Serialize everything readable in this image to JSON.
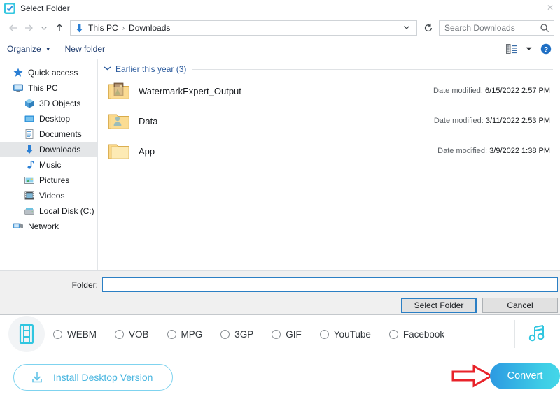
{
  "app": {
    "formats": [
      {
        "label": "WEBM",
        "selected": false
      },
      {
        "label": "VOB",
        "selected": false
      },
      {
        "label": "MPG",
        "selected": false
      },
      {
        "label": "3GP",
        "selected": false
      },
      {
        "label": "GIF",
        "selected": false
      },
      {
        "label": "YouTube",
        "selected": false
      },
      {
        "label": "Facebook",
        "selected": false
      }
    ],
    "film_icon": "film-strip-icon",
    "music_icon": "music-note-icon",
    "install_button": "Install Desktop Version",
    "install_icon": "download-icon",
    "convert_button": "Convert",
    "annotation_icon": "red-arrow-pointer",
    "colors": {
      "convert_gradient_start": "#2c9ae2",
      "convert_gradient_end": "#44d6e8",
      "install_accent": "#49b6e0",
      "annotation_red": "#e8232a"
    }
  },
  "dialog": {
    "title": "Select Folder",
    "title_icon": "checkmark-app-icon",
    "close_label": "✕",
    "nav": {
      "back_icon": "arrow-left-icon",
      "forward_icon": "arrow-right-icon",
      "recent_icon": "chevron-down-icon",
      "up_icon": "arrow-up-icon",
      "breadcrumb_icon": "downloads-arrow-icon",
      "breadcrumbs": [
        "This PC",
        "Downloads"
      ],
      "separator": "›",
      "address_chevron": "⌄",
      "refresh_icon": "refresh-icon",
      "refresh_glyph": "↻"
    },
    "search": {
      "placeholder": "Search Downloads",
      "icon": "search-icon"
    },
    "commands": {
      "organize": "Organize",
      "organize_caret": "▼",
      "new_folder": "New folder",
      "view_icon": "view-mode-icon",
      "view_caret": "▼",
      "help_icon": "help-icon",
      "help_glyph": "?"
    },
    "sidebar": [
      {
        "label": "Quick access",
        "icon": "star-icon",
        "level": 0,
        "selected": false
      },
      {
        "label": "This PC",
        "icon": "computer-icon",
        "level": 0,
        "selected": false
      },
      {
        "label": "3D Objects",
        "icon": "3d-objects-icon",
        "level": 1,
        "selected": false
      },
      {
        "label": "Desktop",
        "icon": "desktop-icon",
        "level": 1,
        "selected": false
      },
      {
        "label": "Documents",
        "icon": "documents-icon",
        "level": 1,
        "selected": false
      },
      {
        "label": "Downloads",
        "icon": "downloads-icon",
        "level": 1,
        "selected": true
      },
      {
        "label": "Music",
        "icon": "music-icon",
        "level": 1,
        "selected": false
      },
      {
        "label": "Pictures",
        "icon": "pictures-icon",
        "level": 1,
        "selected": false
      },
      {
        "label": "Videos",
        "icon": "videos-icon",
        "level": 1,
        "selected": false
      },
      {
        "label": "Local Disk (C:)",
        "icon": "disk-icon",
        "level": 1,
        "selected": false
      },
      {
        "label": "Network",
        "icon": "network-icon",
        "level": 0,
        "selected": false
      }
    ],
    "filelist": {
      "group_header": "Earlier this year (3)",
      "group_chevron": "⌄",
      "date_prefix": "Date modified:",
      "rows": [
        {
          "name": "WatermarkExpert_Output",
          "date": "6/15/2022 2:57 PM",
          "icon": "folder-photo-icon"
        },
        {
          "name": "Data",
          "date": "3/11/2022 2:53 PM",
          "icon": "folder-user-icon"
        },
        {
          "name": "App",
          "date": "3/9/2022 1:38 PM",
          "icon": "folder-icon"
        }
      ]
    },
    "footer": {
      "folder_label": "Folder:",
      "folder_value": "",
      "select_button": "Select Folder",
      "cancel_button": "Cancel"
    }
  }
}
